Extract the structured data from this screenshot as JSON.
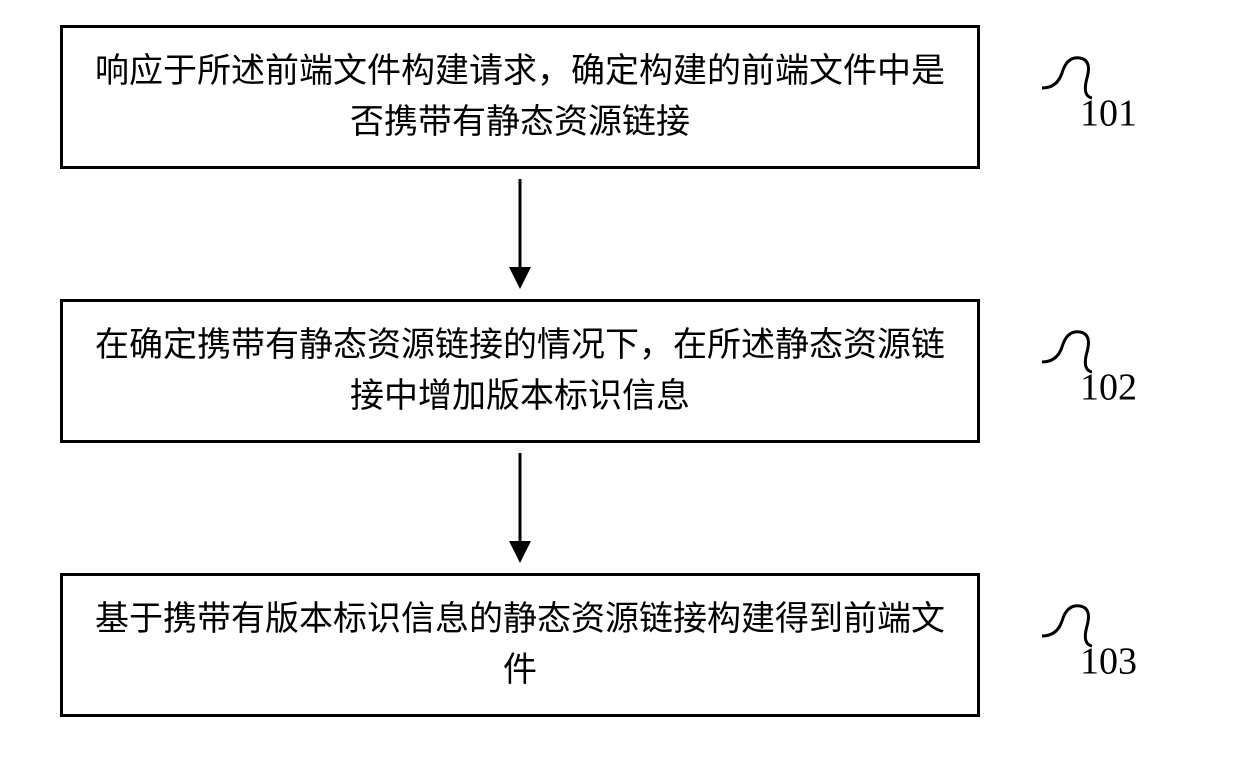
{
  "diagram": {
    "steps": [
      {
        "text": "响应于所述前端文件构建请求，确定构建的前端文件中是否携带有静态资源链接",
        "label": "101"
      },
      {
        "text": "在确定携带有静态资源链接的情况下，在所述静态资源链接中增加版本标识信息",
        "label": "102"
      },
      {
        "text": "基于携带有版本标识信息的静态资源链接构建得到前端文件",
        "label": "103"
      }
    ]
  }
}
